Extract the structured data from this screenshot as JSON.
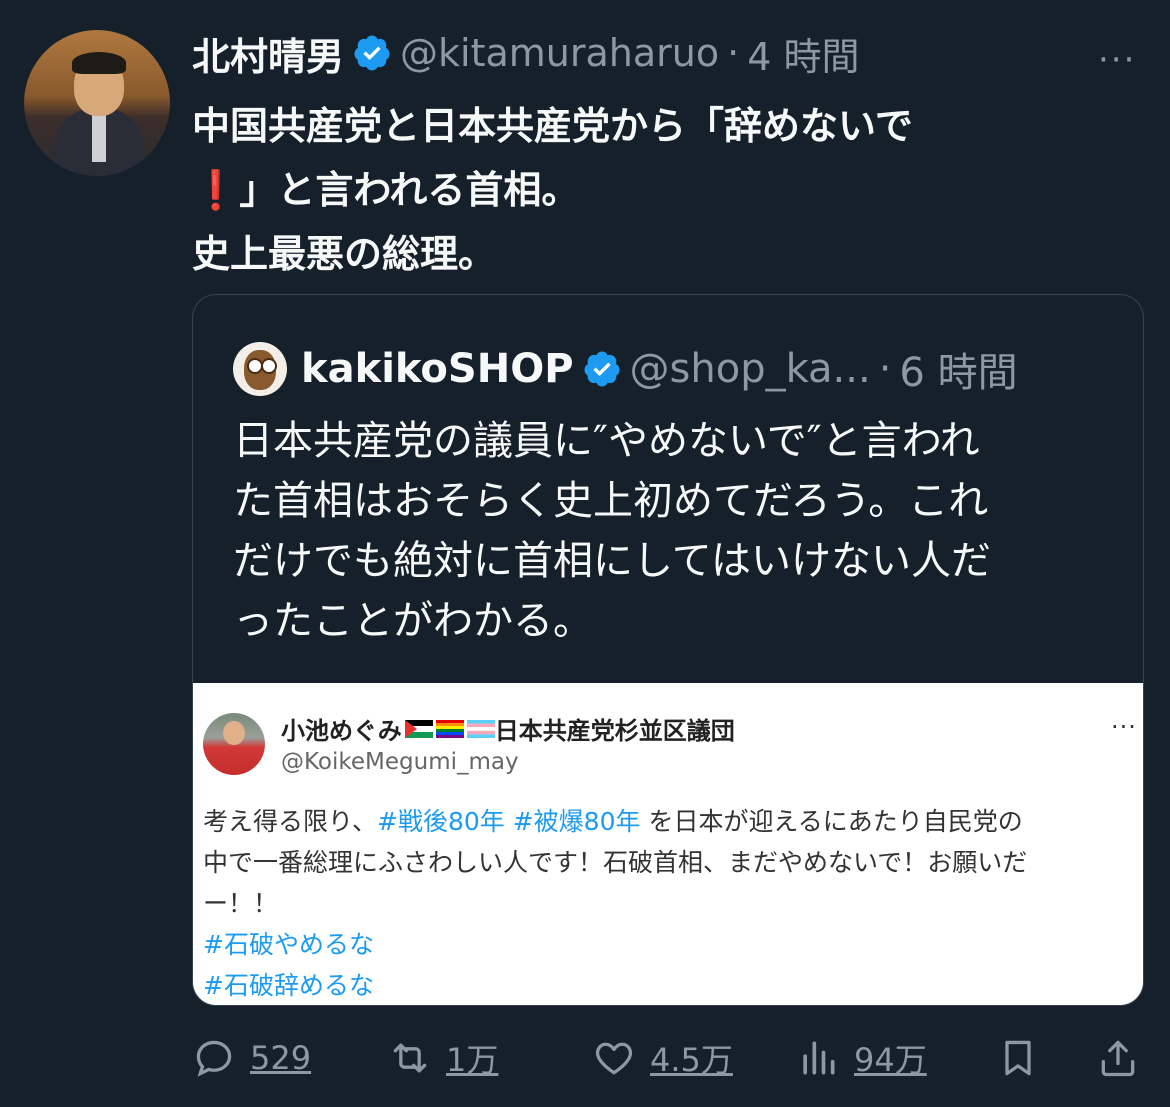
{
  "tweet": {
    "author_name": "北村晴男",
    "handle": "@kitamuraharuo",
    "separator": "·",
    "time": "4 時間",
    "more": "···",
    "text_lines": [
      "中国共産党と日本共産党から「辞めないで",
      "❗」と言われる首相。",
      "史上最悪の総理。"
    ],
    "avatar_icon": "profile-photo"
  },
  "quote": {
    "author_name": "kakikoSHOP",
    "handle": "@shop_ka...",
    "separator": "·",
    "time": "6 時間",
    "text_lines": [
      "日本共産党の議員に″やめないで″と言われ",
      "た首相はおそらく史上初めてだろう。これ",
      "だけでも絶対に首相にしてはいけない人だ",
      "ったことがわかる。"
    ]
  },
  "embed": {
    "author_name": "小池めぐみ",
    "flags": [
      "palestine-flag",
      "rainbow-flag",
      "transgender-flag"
    ],
    "author_suffix": "日本共産党杉並区議団",
    "handle": "@KoikeMegumi_may",
    "more": "···",
    "line1_prefix": "考え得る限り、",
    "line1_tag1": "#戦後80年",
    "line1_tag2": "#被爆80年",
    "line1_suffix": "を日本が迎えるにあたり自民党の",
    "line2": "中で一番総理にふさわしい人です！石破首相、まだやめないで！お願いだ",
    "line3": "ー！！",
    "tag3": "#石破やめるな",
    "tag4": "#石破辞めるな"
  },
  "actions": {
    "replies": "529",
    "retweets": "1万",
    "likes": "4.5万",
    "views": "94万"
  },
  "colors": {
    "background": "#15202b",
    "text": "#f7f9f9",
    "muted": "#8b98a5",
    "verified": "#1d9bf0",
    "link": "#1d9bf0"
  }
}
